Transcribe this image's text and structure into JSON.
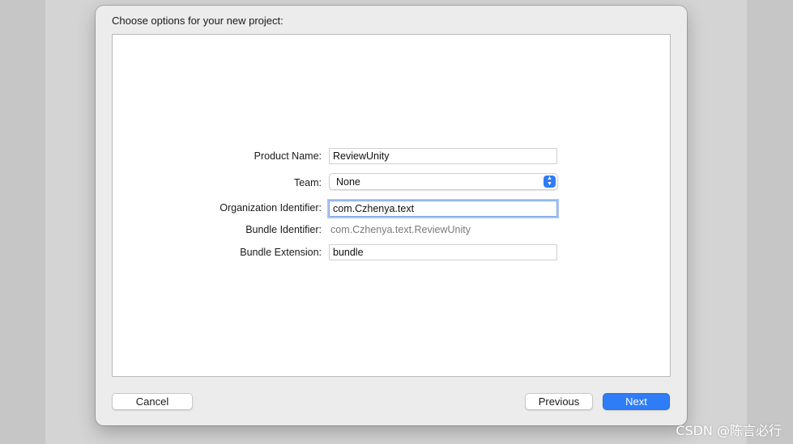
{
  "dialog": {
    "title": "Choose options for your new project:"
  },
  "form": {
    "product_name": {
      "label": "Product Name:",
      "value": "ReviewUnity"
    },
    "team": {
      "label": "Team:",
      "value": "None"
    },
    "organization_identifier": {
      "label": "Organization Identifier:",
      "value": "com.Czhenya.text"
    },
    "bundle_identifier": {
      "label": "Bundle Identifier:",
      "value": "com.Czhenya.text.ReviewUnity"
    },
    "bundle_extension": {
      "label": "Bundle Extension:",
      "value": "bundle"
    }
  },
  "buttons": {
    "cancel": "Cancel",
    "previous": "Previous",
    "next": "Next"
  },
  "icons": {
    "team_popup": "up-down-chevron-icon"
  },
  "colors": {
    "accent": "#2e7cf6",
    "focus_ring": "#a9c6f5"
  },
  "watermark": "CSDN @陈言必行"
}
